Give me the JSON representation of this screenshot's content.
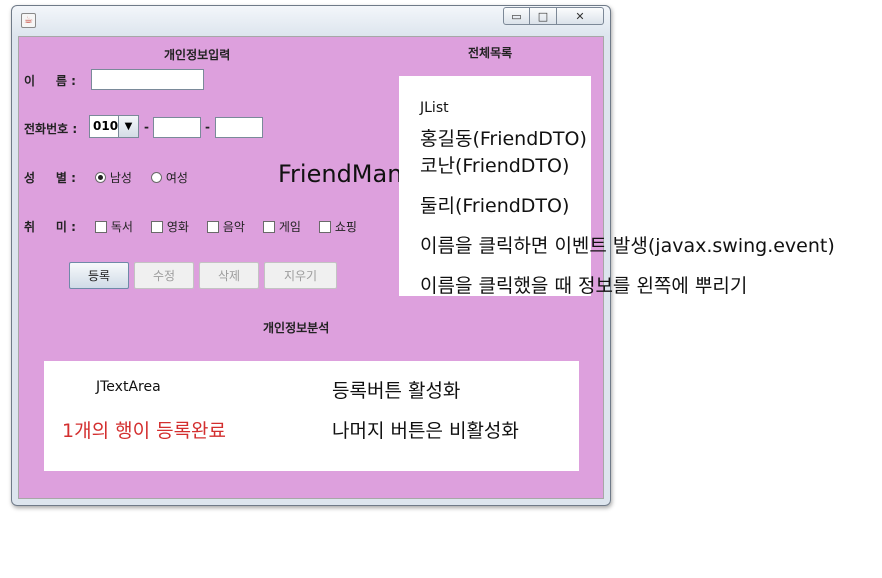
{
  "window": {
    "buttons": {
      "minimize": "▭",
      "maximize": "□",
      "close": "✕"
    }
  },
  "form": {
    "header": "개인정보입력",
    "name_label": "이     름 :",
    "phone_label": "전화번호 :",
    "phone_prefix": "010",
    "dash": "-",
    "gender_label": "성     별 :",
    "gender_male": "남성",
    "gender_female": "여성",
    "hobby_label": "취     미 :",
    "hobbies": [
      "독서",
      "영화",
      "음악",
      "게임",
      "쇼핑"
    ],
    "buttons": {
      "register": "등록",
      "modify": "수정",
      "delete": "삭제",
      "clear": "지우기"
    }
  },
  "list": {
    "header": "전체목록",
    "jlist_label": "JList",
    "items": [
      "홍길동(FriendDTO)",
      "코난(FriendDTO)",
      "둘리(FriendDTO)"
    ]
  },
  "center_title": "FriendMan",
  "analysis": {
    "header": "개인정보분석"
  },
  "textarea": {
    "label": "JTextArea",
    "message": "1개의 행이 등록완료",
    "message_color": "#d32f2f"
  },
  "annotations": {
    "click_event": "이름을 클릭하면 이벤트 발생(javax.swing.event)",
    "click_info": "이름을 클릭했을 때 정보를 왼쪽에 뿌리기",
    "enable_register": "등록버튼 활성화",
    "disable_others": "나머지 버튼은 비활성화"
  },
  "colors": {
    "panel_bg": "#dda0dd"
  }
}
